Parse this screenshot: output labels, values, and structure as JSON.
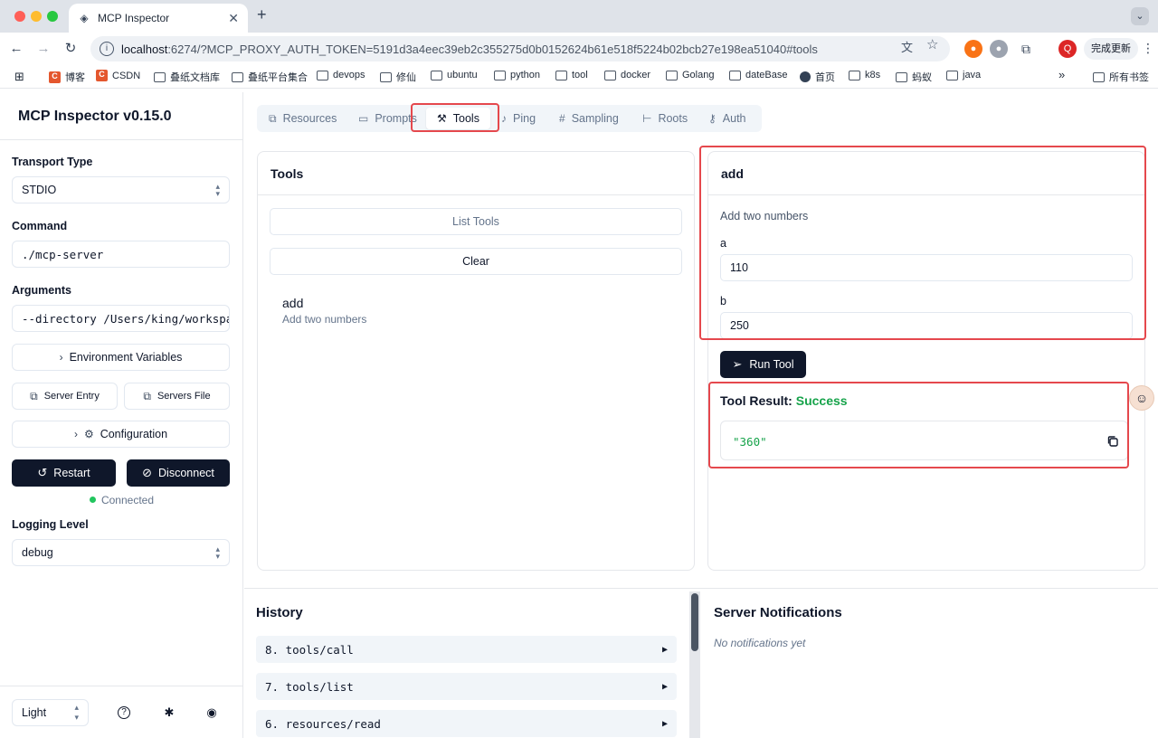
{
  "browser": {
    "tab_title": "MCP Inspector",
    "url_host": "localhost",
    "url_rest": ":6274/?MCP_PROXY_AUTH_TOKEN=5191d3a4eec39eb2c355275d0b0152624b61e518f5224b02bcb27e198ea51040#tools",
    "update_label": "完成更新",
    "profile_initial": "Q",
    "bookmarks": [
      "博客",
      "CSDN",
      "叠纸文档库",
      "叠纸平台集合",
      "devops",
      "修仙",
      "ubuntu",
      "python",
      "tool",
      "docker",
      "Golang",
      "dateBase",
      "首页",
      "k8s",
      "蚂蚁",
      "java"
    ],
    "bookmarks_more": "»",
    "all_bookmarks": "所有书签"
  },
  "sidebar": {
    "title": "MCP Inspector v0.15.0",
    "transport_label": "Transport Type",
    "transport_value": "STDIO",
    "command_label": "Command",
    "command_value": "./mcp-server",
    "arguments_label": "Arguments",
    "arguments_value": "--directory /Users/king/workspa",
    "env_vars_label": "Environment Variables",
    "server_entry_label": "Server Entry",
    "servers_file_label": "Servers File",
    "configuration_label": "Configuration",
    "restart_label": "Restart",
    "disconnect_label": "Disconnect",
    "status_text": "Connected",
    "logging_label": "Logging Level",
    "logging_value": "debug",
    "theme_value": "Light"
  },
  "tabs": [
    "Resources",
    "Prompts",
    "Tools",
    "Ping",
    "Sampling",
    "Roots",
    "Auth"
  ],
  "tools_panel": {
    "title": "Tools",
    "list_tools_label": "List Tools",
    "clear_label": "Clear",
    "items": [
      {
        "name": "add",
        "description": "Add two numbers"
      }
    ]
  },
  "tool_detail": {
    "name": "add",
    "description": "Add two numbers",
    "params": [
      {
        "label": "a",
        "value": "110"
      },
      {
        "label": "b",
        "value": "250"
      }
    ],
    "run_label": "Run Tool",
    "result_label": "Tool Result:",
    "result_status": "Success",
    "result_value": "\"360\""
  },
  "history": {
    "title": "History",
    "items": [
      "8. tools/call",
      "7. tools/list",
      "6. resources/read"
    ]
  },
  "notifications": {
    "title": "Server Notifications",
    "empty_text": "No notifications yet"
  },
  "colors": {
    "primary_dark": "#0f172a",
    "success": "#16a34a",
    "highlight": "#e5484d"
  }
}
